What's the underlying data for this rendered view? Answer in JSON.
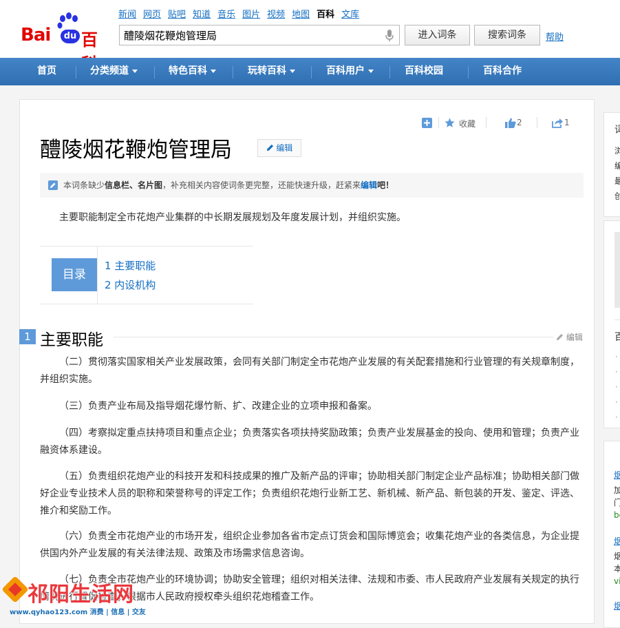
{
  "header": {
    "logo_bai": "Bai",
    "logo_du": "du",
    "logo_baike": "百科",
    "topnav": [
      "新闻",
      "网页",
      "贴吧",
      "知道",
      "音乐",
      "图片",
      "视频",
      "地图",
      "百科",
      "文库"
    ],
    "topnav_active": "百科",
    "search_value": "醴陵烟花鞭炮管理局",
    "enter_button": "进入词条",
    "search_button": "搜索词条",
    "help": "帮助"
  },
  "mainnav": {
    "home": "首页",
    "categories": "分类频道",
    "featured": "特色百科",
    "play": "玩转百科",
    "users": "百科用户",
    "campus": "百科校园",
    "partners": "百科合作"
  },
  "toolbar": {
    "collect": "收藏",
    "likes": "2",
    "shares": "1"
  },
  "article": {
    "title": "醴陵烟花鞭炮管理局",
    "edit": "编辑",
    "notice_prefix": "本词条缺少",
    "notice_missing": "信息栏、名片图",
    "notice_mid": "，补充相关内容使词条更完整，还能快速升级，赶紧来",
    "notice_edit": "编辑",
    "notice_suffix": "吧！",
    "summary": "主要职能制定全市花炮产业集群的中长期发展规划及年度发展计划，并组织实施。",
    "toc_label": "目录",
    "toc_items": [
      "1  主要职能",
      "2  内设机构"
    ],
    "section_num": "1",
    "section_title": "主要职能",
    "section_edit": "编辑",
    "paragraphs": [
      "（二）贯彻落实国家相关产业发展政策，会同有关部门制定全市花炮产业发展的有关配套措施和行业管理的有关规章制度，并组织实施。",
      "（三）负责产业布局及指导烟花爆竹新、扩、改建企业的立项申报和备案。",
      "（四）考察拟定重点扶持项目和重点企业；负责落实各项扶持奖励政策；负责产业发展基金的投向、使用和管理；负责产业融资体系建设。",
      "（五）负责组织花炮产业的科技开发和科技成果的推广及新产品的评审；协助相关部门制定企业产品标准；协助相关部门做好企业专业技术人员的职称和荣誉称号的评定工作；负责组织花炮行业新工艺、新机械、新产品、新包装的开发、鉴定、评选、推介和奖励工作。",
      "（六）负责全市花炮产业的市场开发，组织企业参加各省市定点订货会和国际博览会；收集花炮产业的各类信息，为企业提供国内外产业发展的有关法律法规、政策及市场需求信息咨询。",
      "（七）负责全市花炮产业的环境协调；协助安全管理；组织对相关法律、法规和市委、市人民政府产业发展有关规定的执行情况进行督促检查；根据市人民政府授权牵头组织花炮稽查工作。"
    ]
  },
  "sidebar": {
    "s1": "词",
    "s1_lines": [
      "浏",
      "编",
      "最",
      "创"
    ],
    "s2": "百",
    "s3_lines": [
      "烟",
      "加",
      "门",
      "bo",
      "烟",
      "烟",
      "本",
      "vi",
      "烟"
    ]
  },
  "watermark": {
    "name": "祁阳生活网",
    "url": "www.qyhao123.com 消费 | 信息 | 交友"
  },
  "colors": {
    "nav_blue": "#3b7bbf",
    "link_blue": "#136ec2",
    "brand_red": "#e10602",
    "toc_blue": "#5e9ad9"
  }
}
